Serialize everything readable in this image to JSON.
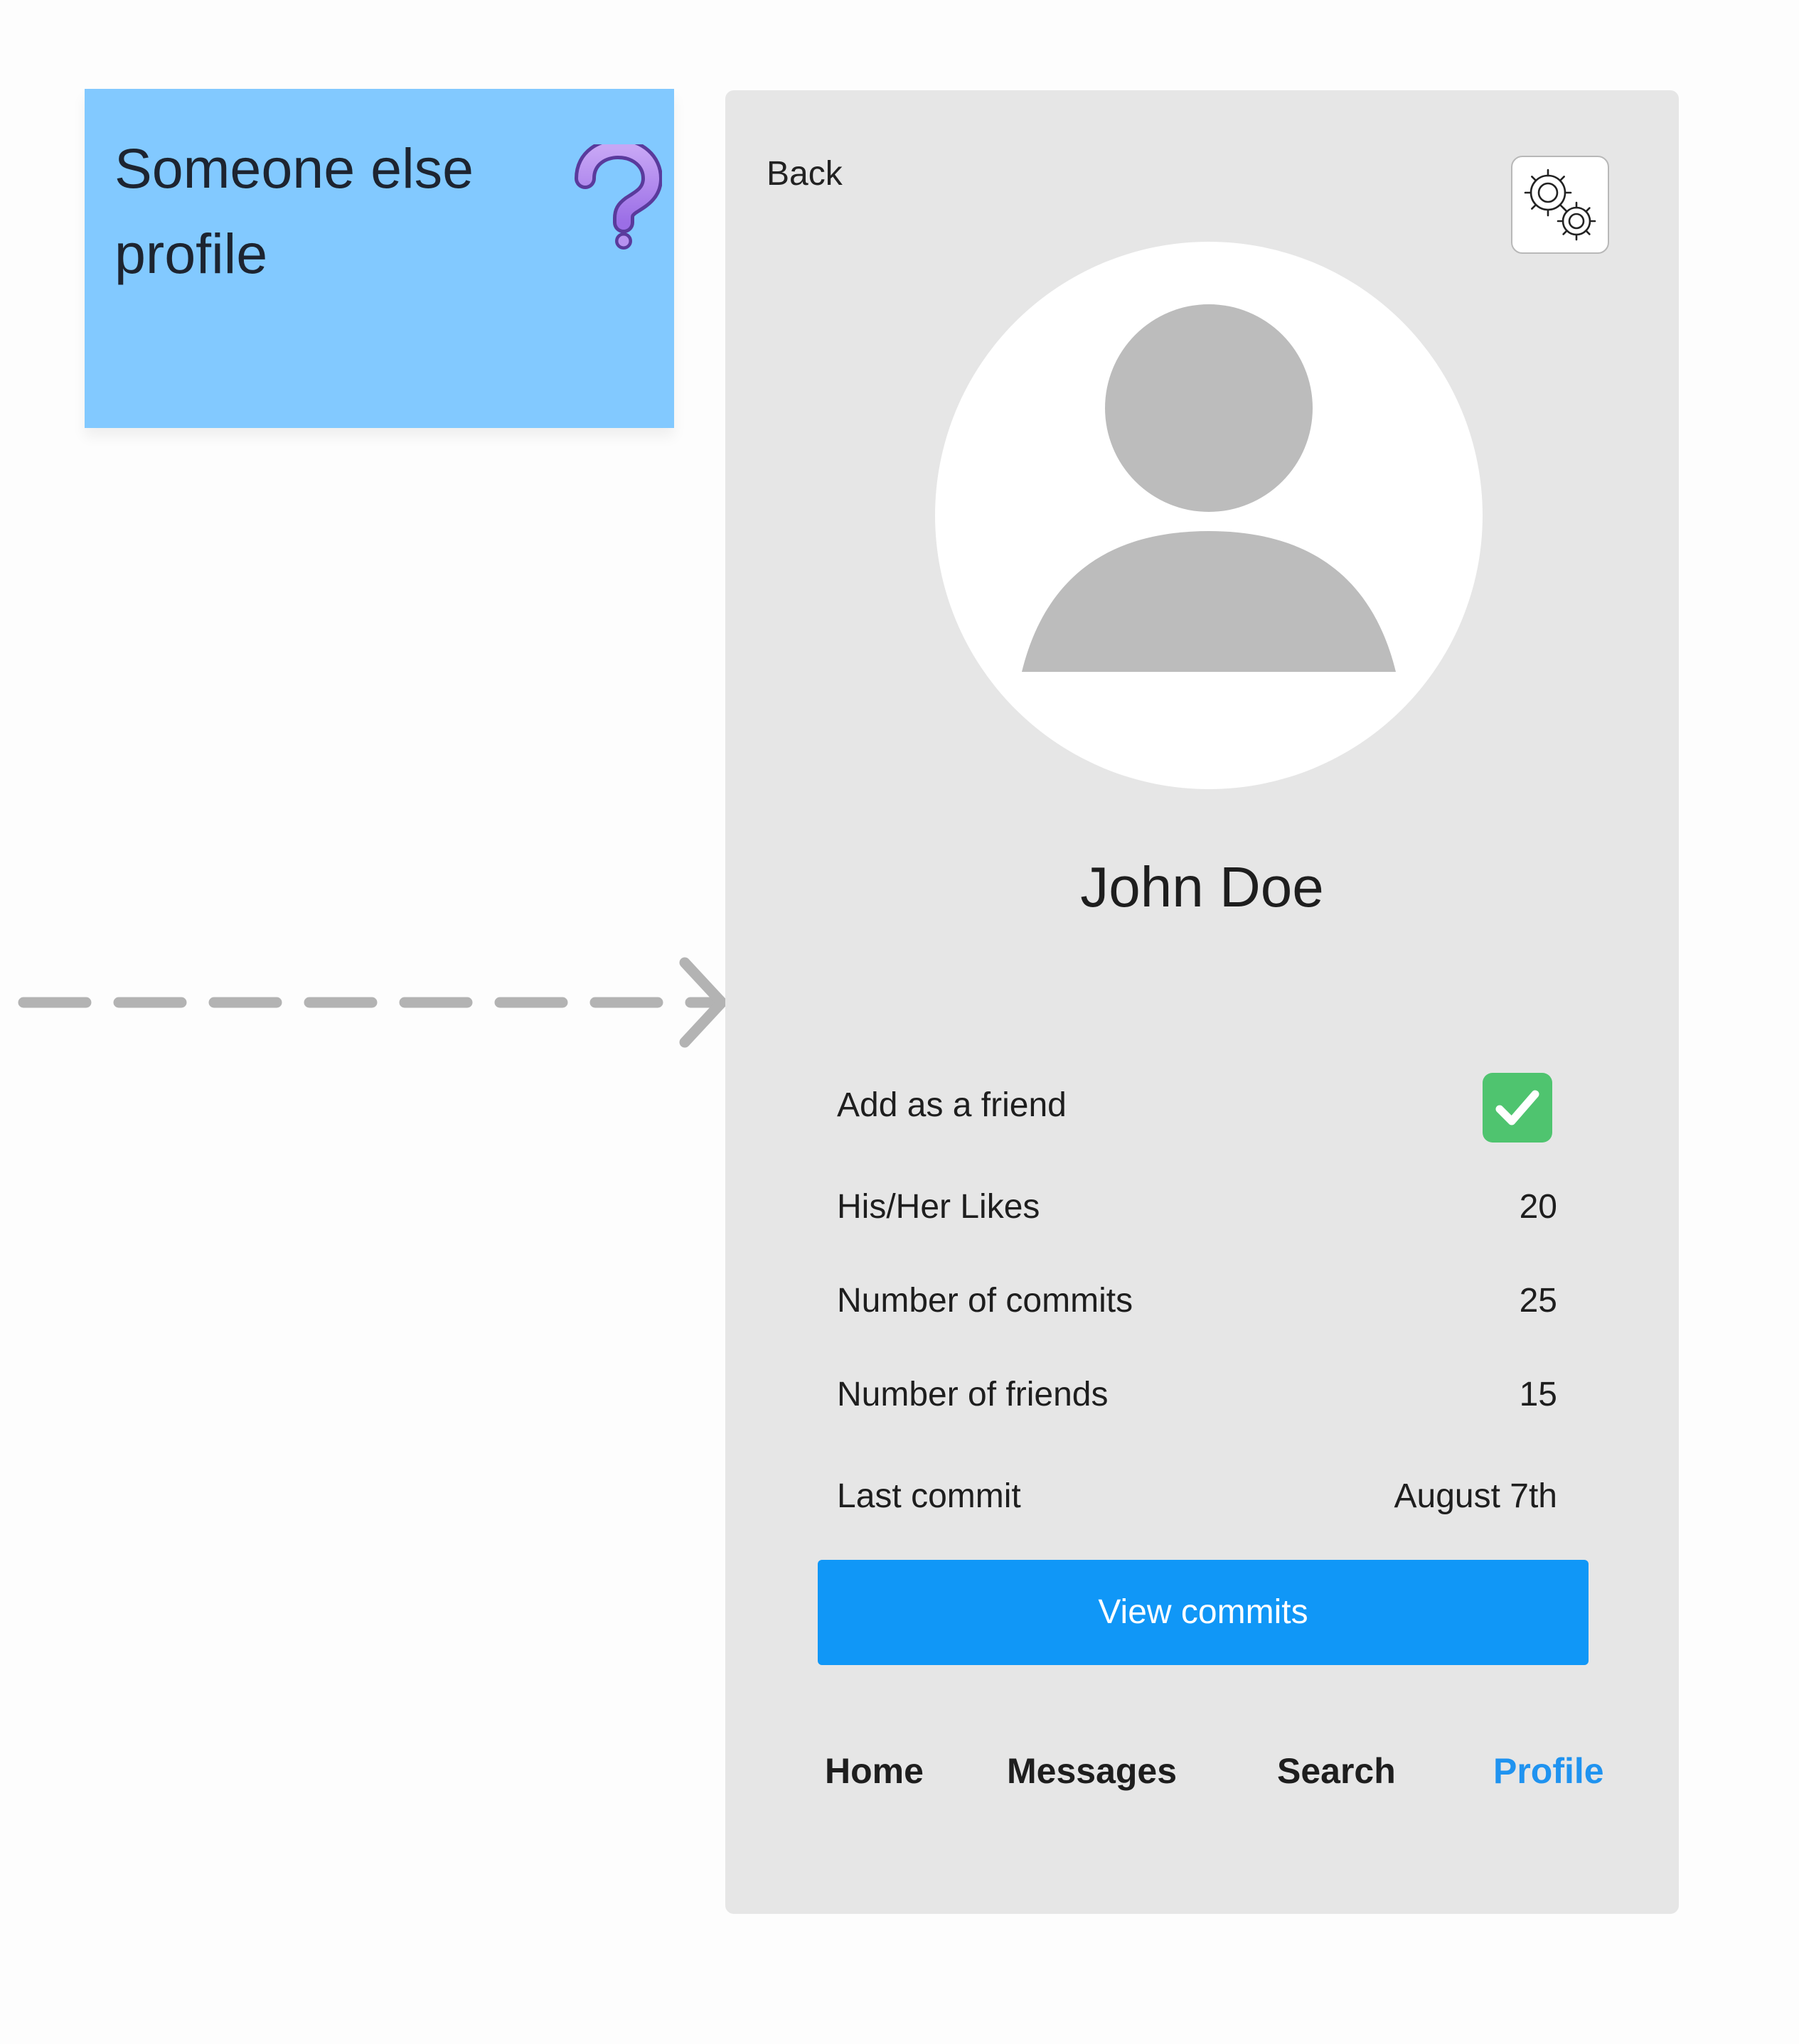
{
  "sticky_note": {
    "text": "Someone else profile",
    "icon": "question-mark-icon",
    "background_color": "#82c9ff"
  },
  "flow_arrow": {
    "icon": "dashed-arrow-right-icon",
    "color": "#b3b3b3"
  },
  "profile_screen": {
    "back_label": "Back",
    "settings_icon": "gears-icon",
    "avatar_icon": "user-placeholder-icon",
    "name": "John Doe",
    "stats": [
      {
        "label": "Add as a friend",
        "type": "checkbox",
        "checked": true
      },
      {
        "label": "His/Her Likes",
        "value": "20"
      },
      {
        "label": "Number of commits",
        "value": "25"
      },
      {
        "label": "Number of friends",
        "value": "15"
      },
      {
        "label": "Last commit",
        "value": "August 7th"
      }
    ],
    "view_commits_label": "View commits",
    "nav": {
      "items": [
        "Home",
        "Messages",
        "Search",
        "Profile"
      ],
      "active": "Profile"
    }
  },
  "colors": {
    "frame_background": "#e6e6e6",
    "accent": "#1097f7",
    "active_nav": "#1f93f0",
    "checkbox_green": "#4fc46f",
    "avatar_gray": "#bcbcbc"
  }
}
